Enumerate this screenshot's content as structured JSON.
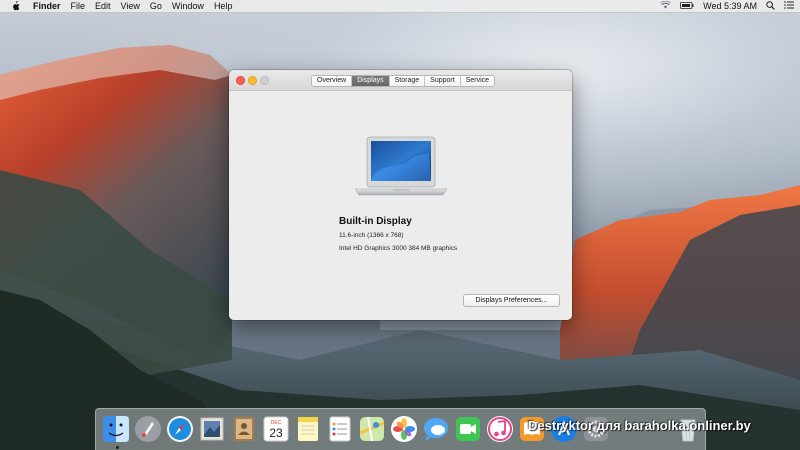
{
  "menubar": {
    "apple_icon": "apple-icon",
    "app_name": "Finder",
    "items": [
      "File",
      "Edit",
      "View",
      "Go",
      "Window",
      "Help"
    ],
    "status_icons": [
      "wifi-icon",
      "battery-icon"
    ],
    "clock": "Wed 5:39 AM",
    "right_icons": [
      "spotlight-icon",
      "notification-center-icon"
    ]
  },
  "window": {
    "tabs": [
      {
        "label": "Overview",
        "active": false
      },
      {
        "label": "Displays",
        "active": true
      },
      {
        "label": "Storage",
        "active": false
      },
      {
        "label": "Support",
        "active": false
      },
      {
        "label": "Service",
        "active": false
      }
    ],
    "display": {
      "name": "Built-in Display",
      "size": "11.6-inch (1366 x 768)",
      "graphics": "Intel HD Graphics 3000 384 MB graphics"
    },
    "prefs_button": "Displays Preferences..."
  },
  "dock": {
    "apps": [
      "finder-icon",
      "launchpad-icon",
      "safari-icon",
      "mail-icon",
      "contacts-icon",
      "calendar-icon",
      "notes-icon",
      "reminders-icon",
      "maps-icon",
      "photos-icon",
      "messages-icon",
      "facetime-icon",
      "itunes-icon",
      "ibooks-icon",
      "app-store-icon",
      "system-preferences-icon",
      "trash-icon"
    ],
    "calendar_month": "DEC",
    "calendar_day": "23"
  },
  "watermark": "Destryktor для baraholka.onliner.by",
  "colors": {
    "close": "#fc5f57",
    "minimize": "#fdbc2e",
    "zoom": "#cfcfcf",
    "active_tab": "#6f6f6f",
    "cliff_glow": "#d9552a"
  }
}
